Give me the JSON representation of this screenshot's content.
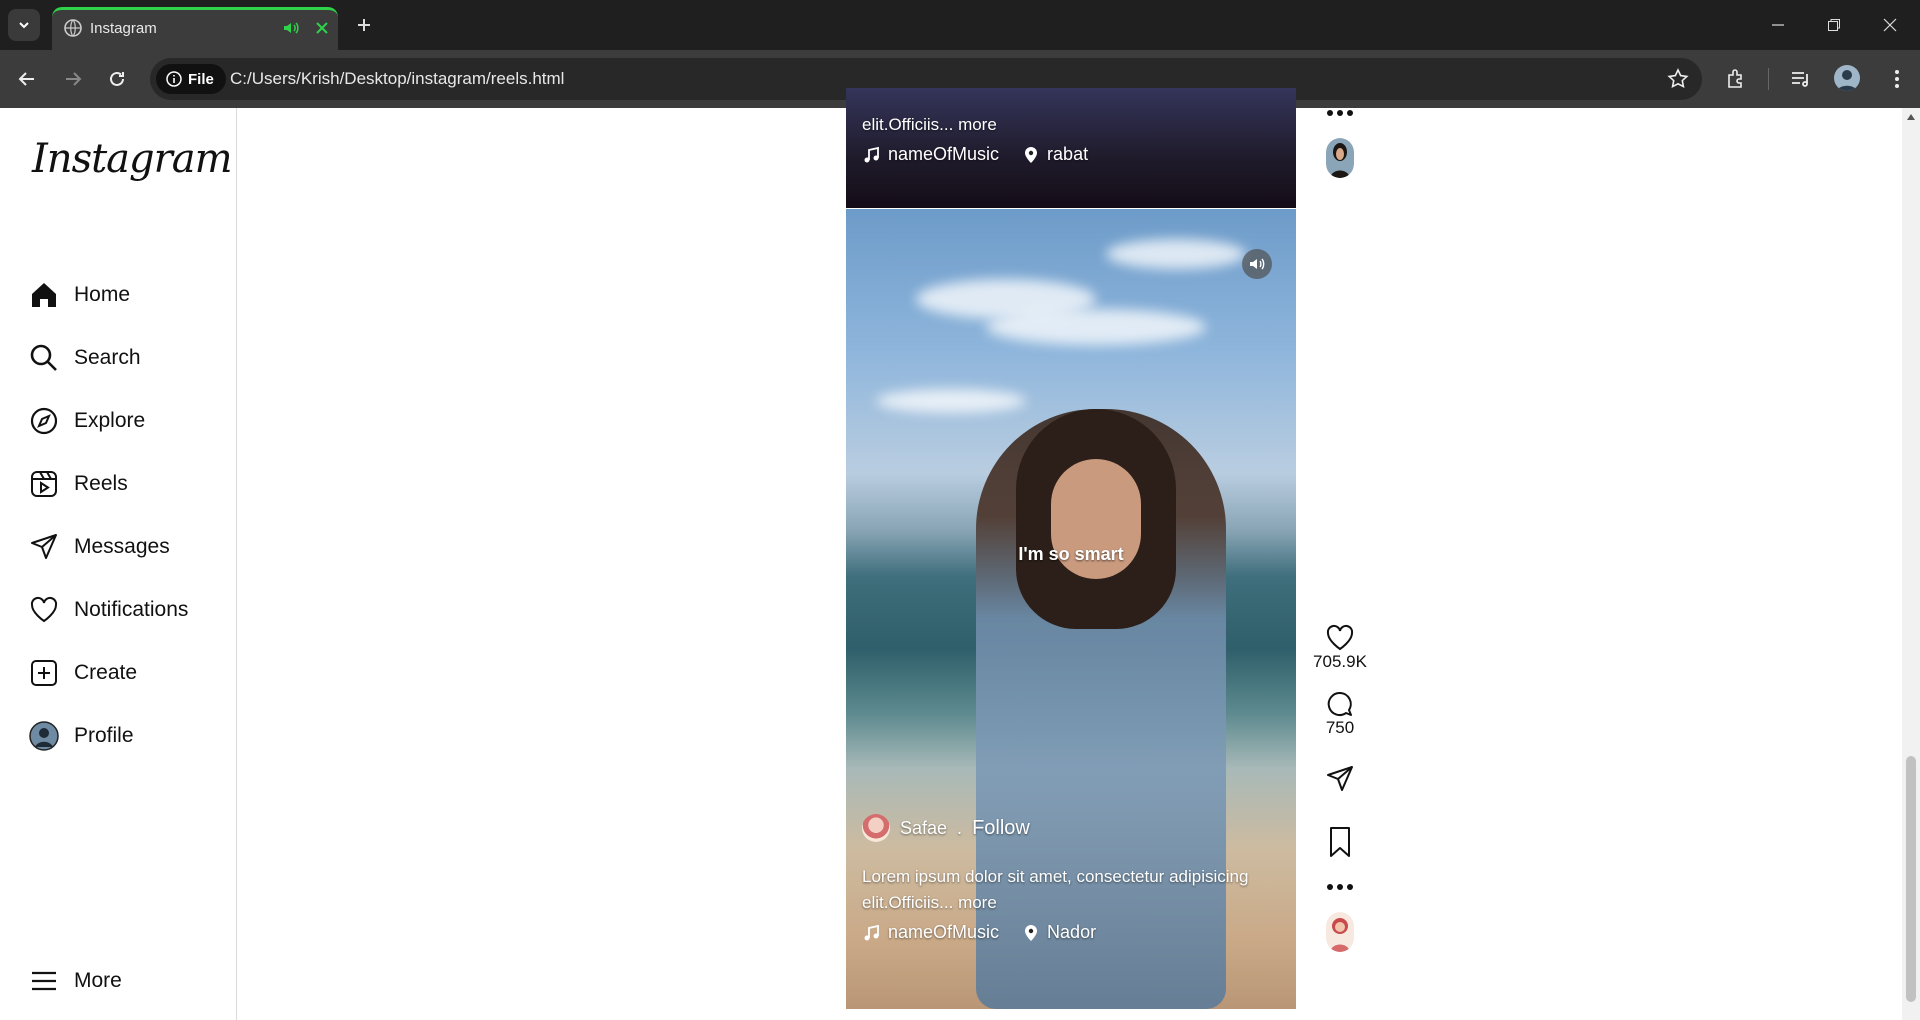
{
  "browser": {
    "tab_title": "Instagram",
    "chip_label": "File",
    "url": "C:/Users/Krish/Desktop/instagram/reels.html"
  },
  "sidebar": {
    "logo": "Instagram",
    "items": [
      {
        "label": "Home",
        "icon": "home-icon"
      },
      {
        "label": "Search",
        "icon": "search-icon"
      },
      {
        "label": "Explore",
        "icon": "compass-icon"
      },
      {
        "label": "Reels",
        "icon": "reels-icon"
      },
      {
        "label": "Messages",
        "icon": "send-icon"
      },
      {
        "label": "Notifications",
        "icon": "heart-icon"
      },
      {
        "label": "Create",
        "icon": "plus-square-icon"
      },
      {
        "label": "Profile",
        "icon": "avatar"
      }
    ],
    "more_label": "More"
  },
  "prev_reel": {
    "caption_tail": "elit.Officiis...",
    "more": "more",
    "music": "nameOfMusic",
    "location": "rabat"
  },
  "reel": {
    "overlay_text": "I'm so smart",
    "username": "Safae",
    "dot": ".",
    "follow": "Follow",
    "caption": "Lorem ipsum dolor sit amet, consectetur adipisicing elit.Officiis...",
    "more": "more",
    "music": "nameOfMusic",
    "location": "Nador",
    "likes": "705.9K",
    "comments": "750"
  },
  "colors": {
    "accent_tab": "#2fd34a",
    "chrome_dark": "#1f1f1f"
  }
}
